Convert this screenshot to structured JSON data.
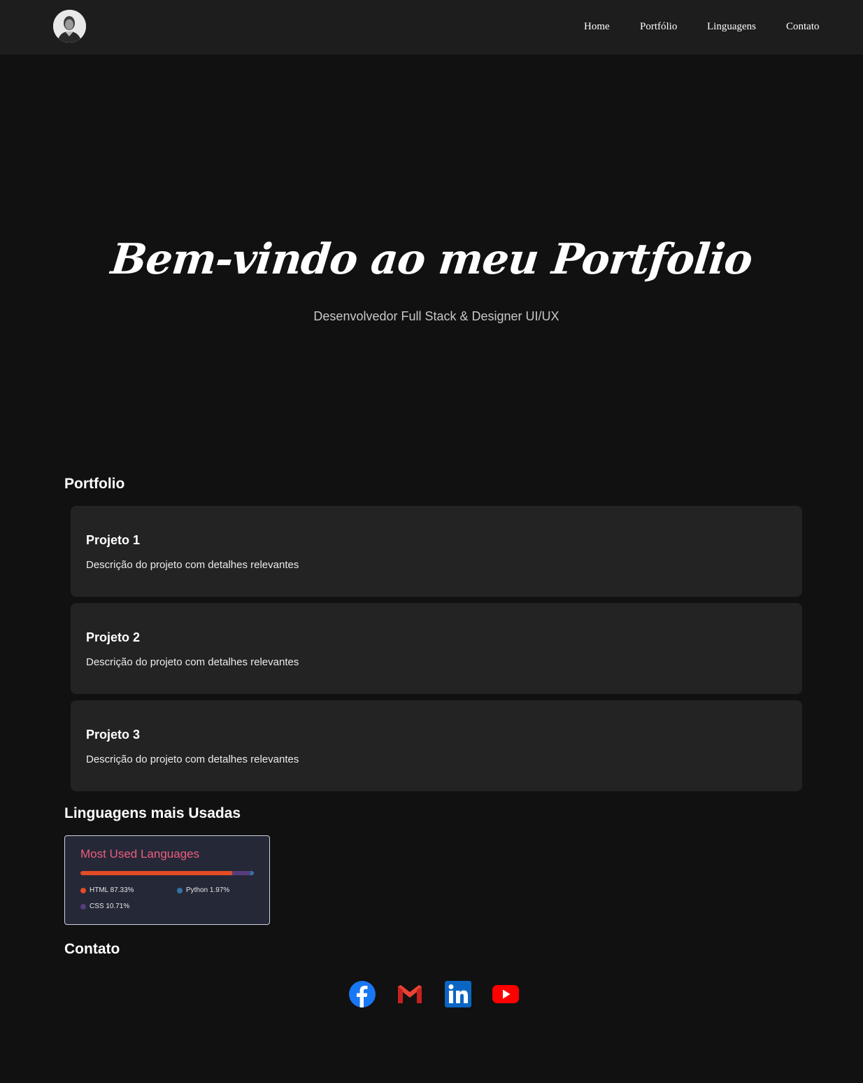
{
  "nav": {
    "links": [
      {
        "label": "Home"
      },
      {
        "label": "Portfólio"
      },
      {
        "label": "Linguagens"
      },
      {
        "label": "Contato"
      }
    ]
  },
  "hero": {
    "title": "Bem-vindo ao meu Portfolio",
    "subtitle": "Desenvolvedor Full Stack & Designer UI/UX"
  },
  "portfolio": {
    "title": "Portfolio",
    "projects": [
      {
        "title": "Projeto 1",
        "description": "Descrição do projeto com detalhes relevantes"
      },
      {
        "title": "Projeto 2",
        "description": "Descrição do projeto com detalhes relevantes"
      },
      {
        "title": "Projeto 3",
        "description": "Descrição do projeto com detalhes relevantes"
      }
    ]
  },
  "languages": {
    "title": "Linguagens mais Usadas",
    "card_title": "Most Used Languages",
    "items": [
      {
        "name": "HTML",
        "percent": 87.33,
        "label": "HTML 87.33%",
        "color": "#e34c26"
      },
      {
        "name": "CSS",
        "percent": 10.71,
        "label": "CSS 10.71%",
        "color": "#563d7c"
      },
      {
        "name": "Python",
        "percent": 1.97,
        "label": "Python 1.97%",
        "color": "#3572a5"
      }
    ]
  },
  "contact": {
    "title": "Contato",
    "socials": [
      {
        "icon": "facebook-icon",
        "color": "#1877f2"
      },
      {
        "icon": "gmail-icon",
        "color": "#ea4335"
      },
      {
        "icon": "linkedin-icon",
        "color": "#0a66c2"
      },
      {
        "icon": "youtube-icon",
        "color": "#ff0000"
      }
    ]
  },
  "colors": {
    "background": "#111111",
    "navbar": "#1d1d1d",
    "card": "#232323",
    "lang_card": "#252837",
    "lang_title": "#ee5d7e"
  }
}
